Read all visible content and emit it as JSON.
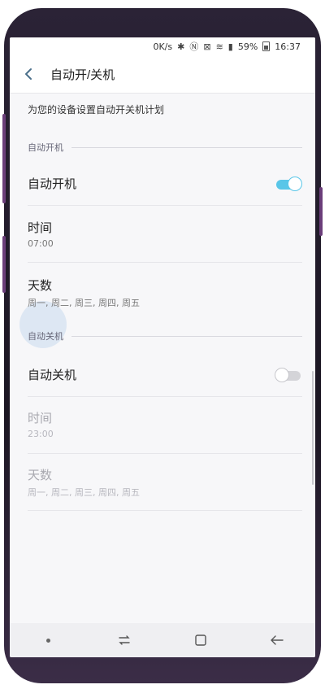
{
  "status_bar": {
    "speed": "0K/s",
    "battery_percent": "59%",
    "time": "16:37"
  },
  "app_bar": {
    "back_icon": "back-arrow-icon",
    "title": "自动开/关机"
  },
  "description": "为您的设备设置自动开关机计划",
  "power_on_section": {
    "header": "自动开机",
    "toggle_label": "自动开机",
    "toggle_state": "on",
    "time_label": "时间",
    "time_value": "07:00",
    "days_label": "天数",
    "days_value": "周一, 周二, 周三, 周四, 周五"
  },
  "power_off_section": {
    "header": "自动关机",
    "toggle_label": "自动关机",
    "toggle_state": "off",
    "time_label": "时间",
    "time_value": "23:00",
    "days_label": "天数",
    "days_value": "周一, 周二, 周三, 周四, 周五"
  },
  "colors": {
    "accent": "#59c6e8",
    "background": "#f7f7f9"
  },
  "nav_bar": {
    "items": [
      "dot-icon",
      "recents-icon",
      "home-icon",
      "back-icon"
    ]
  }
}
